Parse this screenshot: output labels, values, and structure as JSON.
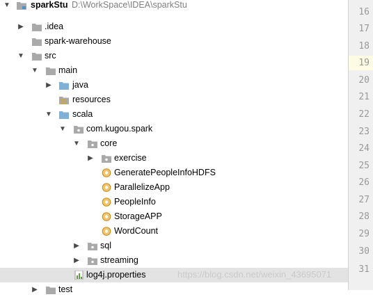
{
  "colors": {
    "folder": "#a9a9a9",
    "java_folder": "#7fb1d8",
    "scala_object": "#e5a125",
    "selection": "#e3e3e3",
    "gutter": "#f0f0f0"
  },
  "tree": {
    "root": {
      "name": "sparkStu",
      "path": "D:\\WorkSpace\\IDEA\\sparkStu"
    },
    "idea": ".idea",
    "warehouse": "spark-warehouse",
    "src": "src",
    "main": "main",
    "java": "java",
    "resources": "resources",
    "scala": "scala",
    "pkg": "com.kugou.spark",
    "core": "core",
    "exercise": "exercise",
    "files": [
      "GeneratePeopleInfoHDFS",
      "ParallelizeApp",
      "PeopleInfo",
      "StorageAPP",
      "WordCount"
    ],
    "sql": "sql",
    "streaming": "streaming",
    "log4j": "log4j.properties",
    "test": "test"
  },
  "gutter": {
    "line_numbers": [
      "16",
      "17",
      "18",
      "19",
      "20",
      "21",
      "22",
      "23",
      "24",
      "25",
      "26",
      "27",
      "28",
      "29",
      "30",
      "31"
    ],
    "current_line": "19"
  },
  "watermark": "https://blog.csdn.net/weixin_43695071"
}
